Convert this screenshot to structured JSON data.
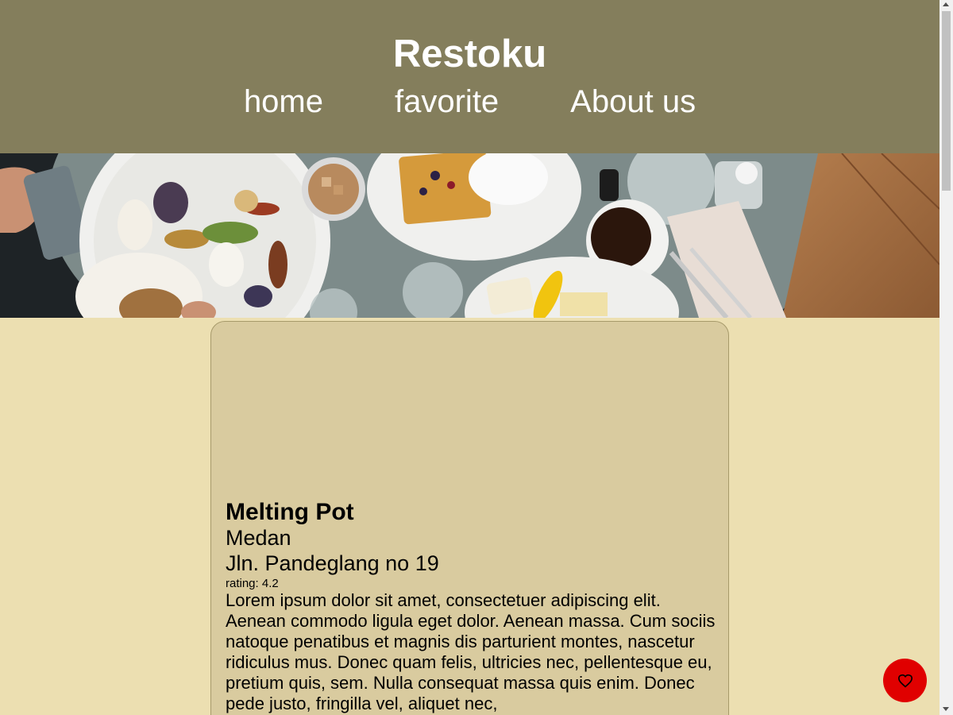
{
  "header": {
    "brand": "Restoku",
    "nav": [
      {
        "label": "home"
      },
      {
        "label": "favorite"
      },
      {
        "label": "About us"
      }
    ]
  },
  "hero": {
    "description_icon": "breakfast-table-photo"
  },
  "restaurant": {
    "name": "Melting Pot",
    "city": "Medan",
    "address": "Jln. Pandeglang no 19",
    "rating": "rating: 4.2",
    "description": "Lorem ipsum dolor sit amet, consectetuer adipiscing elit. Aenean commodo ligula eget dolor. Aenean massa. Cum sociis natoque penatibus et magnis dis parturient montes, nascetur ridiculus mus. Donec quam felis, ultricies nec, pellentesque eu, pretium quis, sem. Nulla consequat massa quis enim. Donec pede justo, fringilla vel, aliquet nec,"
  },
  "favorite_button": {
    "icon": "heart-icon",
    "color": "#e00000"
  },
  "colors": {
    "header": "#847e5c",
    "background": "#ecdfb1",
    "card": "#d9cb9f"
  }
}
